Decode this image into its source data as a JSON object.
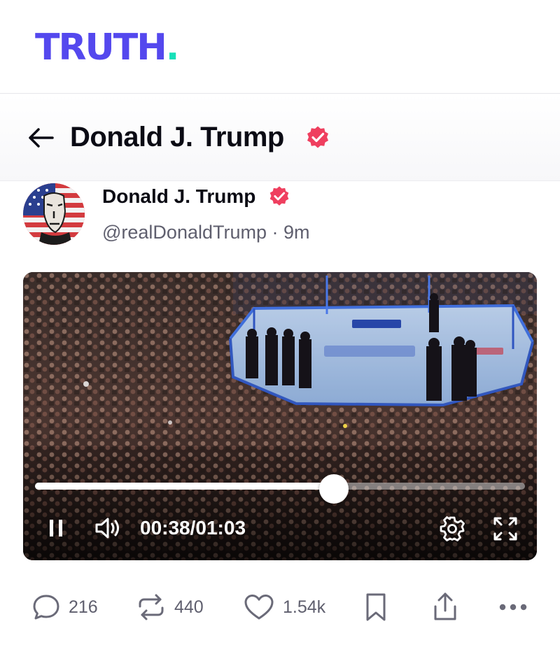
{
  "app": {
    "logo_text": "TRUTH",
    "logo_dot": ".",
    "brand_color": "#5448ee",
    "brand_dot_color": "#17e0b8"
  },
  "profile_header": {
    "title": "Donald J. Trump",
    "back_icon": "arrow-left-icon",
    "verified_icon": "verified-badge-icon",
    "verified_color": "#ef3f5f"
  },
  "post": {
    "author_name": "Donald J. Trump",
    "handle": "@realDonaldTrump",
    "separator": "·",
    "time_ago": "9m",
    "avatar_icon": "flag-portrait-avatar",
    "video": {
      "scene": "arena-octagon-crowd",
      "progress": 0.61,
      "current_time": "00:38",
      "time_separator": "/",
      "duration": "01:03",
      "state": "playing",
      "controls": [
        "pause-icon",
        "volume-icon",
        "settings-gear-icon",
        "fullscreen-icon"
      ]
    },
    "actions": {
      "replies": "216",
      "retruths": "440",
      "likes": "1.54k",
      "icons": [
        "comment-icon",
        "retruth-icon",
        "heart-icon",
        "bookmark-icon",
        "share-icon",
        "more-icon"
      ]
    }
  }
}
